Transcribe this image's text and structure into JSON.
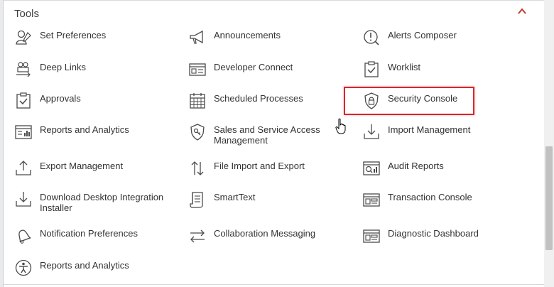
{
  "section": {
    "title": "Tools"
  },
  "items": [
    {
      "label": "Set Preferences",
      "icon": "user-preferences-icon"
    },
    {
      "label": "Announcements",
      "icon": "megaphone-icon"
    },
    {
      "label": "Alerts Composer",
      "icon": "alert-composer-icon"
    },
    {
      "label": "Deep Links",
      "icon": "deep-links-icon"
    },
    {
      "label": "Developer Connect",
      "icon": "developer-connect-icon"
    },
    {
      "label": "Worklist",
      "icon": "clipboard-check-icon"
    },
    {
      "label": "Approvals",
      "icon": "clipboard-check-icon"
    },
    {
      "label": "Scheduled Processes",
      "icon": "calendar-grid-icon"
    },
    {
      "label": "Security Console",
      "icon": "shield-lock-icon"
    },
    {
      "label": "Reports and Analytics",
      "icon": "report-chart-icon"
    },
    {
      "label": "Sales and Service Access Management",
      "icon": "shield-key-icon"
    },
    {
      "label": "Import Management",
      "icon": "import-tray-icon"
    },
    {
      "label": "Export Management",
      "icon": "export-tray-icon"
    },
    {
      "label": "File Import and Export",
      "icon": "up-down-arrows-icon"
    },
    {
      "label": "Audit Reports",
      "icon": "audit-report-icon"
    },
    {
      "label": "Download Desktop Integration Installer",
      "icon": "download-tray-icon"
    },
    {
      "label": "SmartText",
      "icon": "scroll-text-icon"
    },
    {
      "label": "Transaction Console",
      "icon": "console-window-icon"
    },
    {
      "label": "Notification Preferences",
      "icon": "bell-icon"
    },
    {
      "label": "Collaboration Messaging",
      "icon": "swap-arrows-icon"
    },
    {
      "label": "Diagnostic Dashboard",
      "icon": "dashboard-window-icon"
    },
    {
      "label": "Reports and Analytics",
      "icon": "accessibility-person-icon"
    }
  ],
  "colors": {
    "highlight": "#d9262a",
    "collapse_chevron": "#c0392b",
    "text": "#333333",
    "icon": "#4a4a4a"
  }
}
